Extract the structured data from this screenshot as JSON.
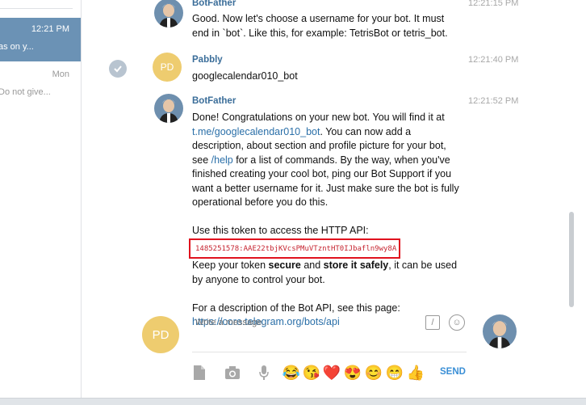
{
  "sidebar": {
    "active_chat": {
      "time": "12:21 PM",
      "snippet": "as on y..."
    },
    "chat_2": {
      "time": "Mon",
      "snippet": "Do not give..."
    }
  },
  "messages": [
    {
      "author": "BotFather",
      "time": "12:21:15 PM",
      "text": "Good. Now let's choose a username for your bot. It must end in `bot`. Like this, for example: TetrisBot or tetris_bot."
    },
    {
      "author": "Pabbly",
      "time": "12:21:40 PM",
      "avatar_initials": "PD",
      "text": "googlecalendar010_bot"
    },
    {
      "author": "BotFather",
      "time": "12:21:52 PM",
      "intro": "Done! Congratulations on your new bot. You will find it at",
      "bot_link": "t.me/googlecalendar010_bot",
      "after_link": ". You can now add a description, about section and profile picture for your bot, see",
      "help_link": "/help",
      "after_help": "for a list of commands. By the way, when you've finished creating your cool bot, ping our Bot Support if you want a better username for it. Just make sure the bot is fully operational before you do this.",
      "token_label": "Use this token to access the HTTP API:",
      "token": "1485251578:AAE22tbjKVcsPMuVTzntHT0IJbafln9wy8A",
      "keep_pre": "Keep your token",
      "keep_secure": "secure",
      "keep_and": "and",
      "keep_store": "store it safely",
      "keep_post": ", it can be used by anyone to control your bot.",
      "api_label": "For a description of the Bot API, see this page:",
      "api_link": "https://core.telegram.org/bots/api"
    }
  ],
  "composer": {
    "avatar_initials": "PD",
    "placeholder": "Write a message...",
    "send_label": "SEND",
    "commands_glyph": "/",
    "emoji_glyph": "☺",
    "tool_glyphs": {
      "file": "📄",
      "camera": "📷",
      "mic": "🎤",
      "joy": "😂",
      "kiss": "😘",
      "heart": "❤️",
      "heart_eyes": "😍",
      "blush": "😊",
      "grin": "😁",
      "thumbs_up": "👍"
    }
  },
  "colors": {
    "accent": "#3a6d99",
    "active_chat": "#6b92b5",
    "avatar_pd": "#eecc6f",
    "token_red": "#c6232f",
    "highlight_box": "#e0121e",
    "send": "#3a8fd6"
  },
  "icons": [
    "file-icon",
    "camera-icon",
    "microphone-icon",
    "check-icon",
    "emoji-icon",
    "commands-icon"
  ]
}
